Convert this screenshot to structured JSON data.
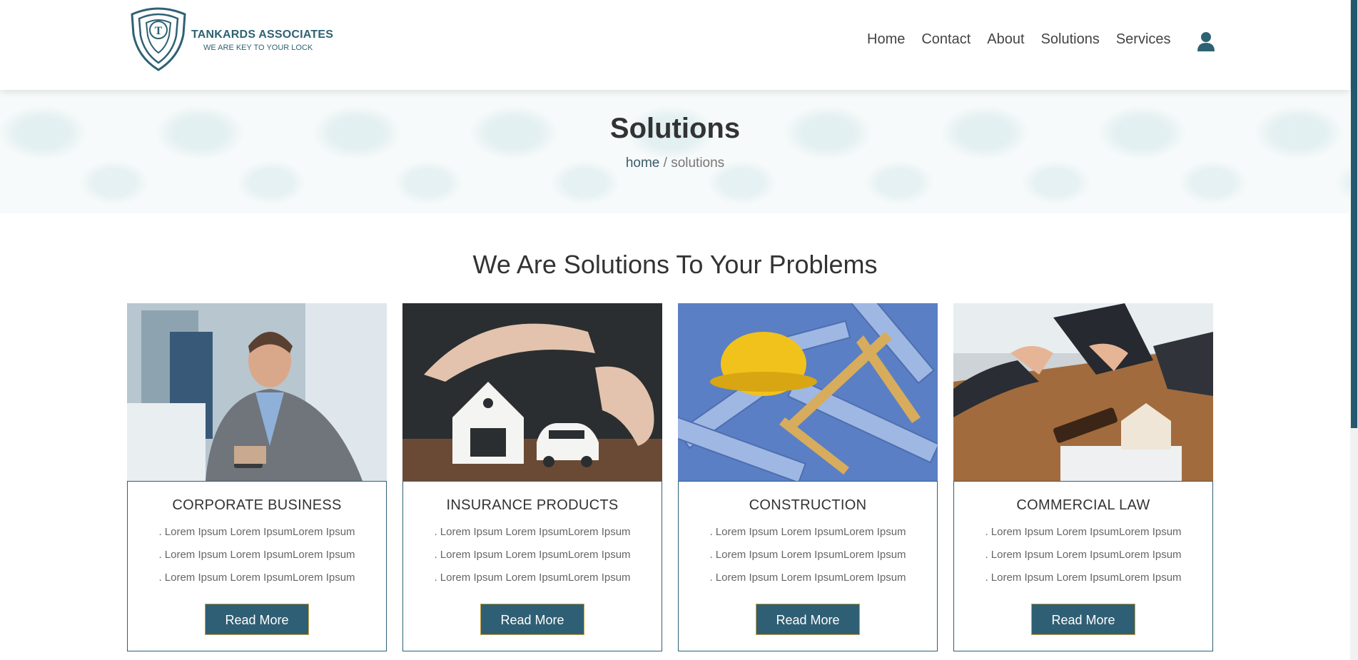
{
  "header": {
    "logo_title": "TANKARDS ASSOCIATES",
    "logo_tagline": "WE ARE KEY TO YOUR LOCK",
    "nav": [
      "Home",
      "Contact",
      "About",
      "Solutions",
      "Services"
    ],
    "user_icon": "user-icon"
  },
  "hero": {
    "title": "Solutions",
    "breadcrumb_home": "home",
    "breadcrumb_sep": " / ",
    "breadcrumb_current": "solutions"
  },
  "section": {
    "title": "We Are Solutions To Your Problems"
  },
  "cards": [
    {
      "title": "CORPORATE BUSINESS",
      "lines": [
        ". Lorem Ipsum Lorem IpsumLorem Ipsum",
        ". Lorem Ipsum Lorem IpsumLorem Ipsum",
        ". Lorem Ipsum Lorem IpsumLorem Ipsum"
      ],
      "button": "Read More"
    },
    {
      "title": "INSURANCE PRODUCTS",
      "lines": [
        ". Lorem Ipsum Lorem IpsumLorem Ipsum",
        ". Lorem Ipsum Lorem IpsumLorem Ipsum",
        ". Lorem Ipsum Lorem IpsumLorem Ipsum"
      ],
      "button": "Read More"
    },
    {
      "title": "CONSTRUCTION",
      "lines": [
        ". Lorem Ipsum Lorem IpsumLorem Ipsum",
        ". Lorem Ipsum Lorem IpsumLorem Ipsum",
        ". Lorem Ipsum Lorem IpsumLorem Ipsum"
      ],
      "button": "Read More"
    },
    {
      "title": "COMMERCIAL LAW",
      "lines": [
        ". Lorem Ipsum Lorem IpsumLorem Ipsum",
        ". Lorem Ipsum Lorem IpsumLorem Ipsum",
        ". Lorem Ipsum Lorem IpsumLorem Ipsum"
      ],
      "button": "Read More"
    }
  ],
  "colors": {
    "brand": "#2e6273",
    "button": "#2f5f74",
    "button_border": "#c7a243",
    "card_border": "#2f5f78"
  }
}
